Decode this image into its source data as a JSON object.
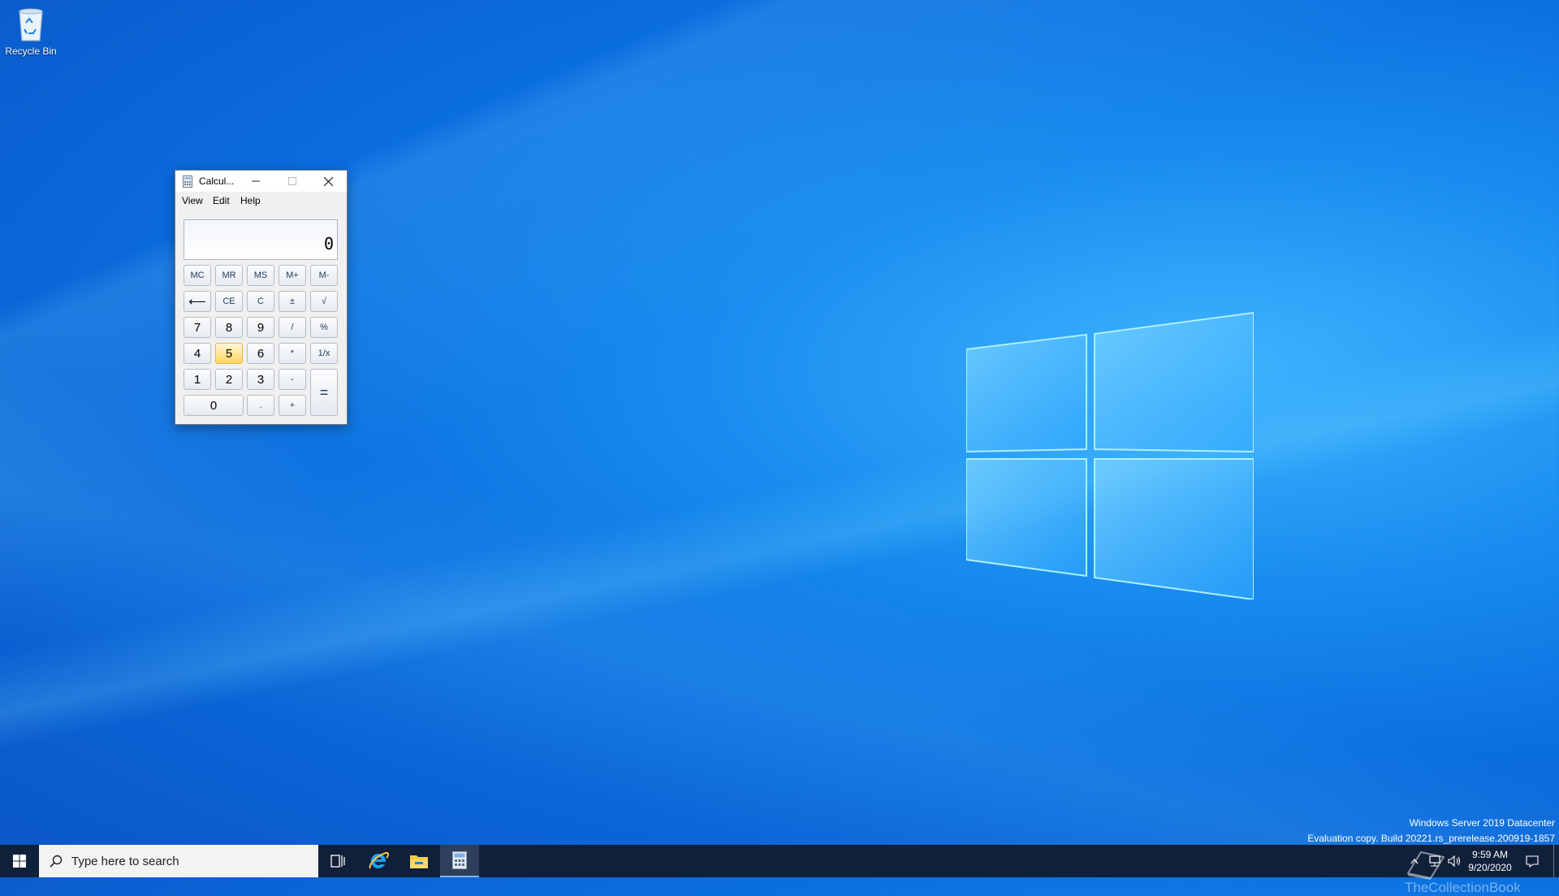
{
  "desktop": {
    "recycle_bin_label": "Recycle Bin",
    "watermark_line1": "Windows Server 2019 Datacenter",
    "watermark_line2": "Evaluation copy. Build 20221.rs_prerelease.200919-1857",
    "overlay_text": "TheCollectionBook"
  },
  "calculator": {
    "title": "Calcul...",
    "menu": [
      "View",
      "Edit",
      "Help"
    ],
    "display_value": "0",
    "buttons": {
      "mc": "MC",
      "mr": "MR",
      "ms": "MS",
      "mplus": "M+",
      "mminus": "M-",
      "back": "⟵",
      "ce": "CE",
      "c": "C",
      "plusminus": "±",
      "sqrt": "√",
      "n7": "7",
      "n8": "8",
      "n9": "9",
      "div": "/",
      "pct": "%",
      "n4": "4",
      "n5": "5",
      "n6": "6",
      "mul": "*",
      "recip": "1/x",
      "n1": "1",
      "n2": "2",
      "n3": "3",
      "sub": "-",
      "eq": "=",
      "n0": "0",
      "dot": ".",
      "add": "+"
    },
    "highlighted_button": "5"
  },
  "taskbar": {
    "search_placeholder": "Type here to search",
    "time": "9:59 AM",
    "date": "9/20/2020"
  },
  "colors": {
    "taskbar": "#10203a",
    "desktop_accent": "#1a8ff0",
    "highlight_button": "#ffd75c"
  }
}
